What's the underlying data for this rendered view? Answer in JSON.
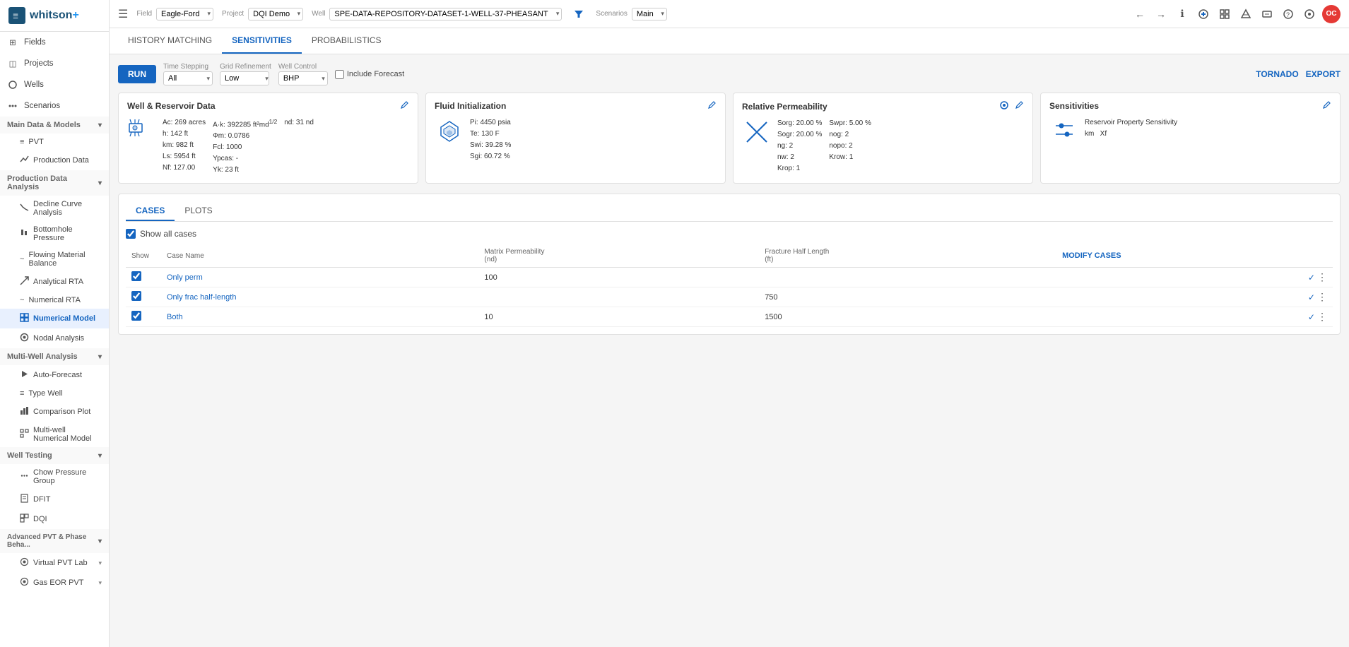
{
  "app": {
    "logo_text": "whitson",
    "logo_plus": "+",
    "menu_icon": "☰"
  },
  "topbar": {
    "field_label": "Field",
    "field_value": "Eagle-Ford",
    "project_label": "Project",
    "project_value": "DQI Demo",
    "well_label": "Well",
    "well_value": "SPE-DATA-REPOSITORY-DATASET-1-WELL-37-PHEASANT",
    "scenarios_label": "Scenarios",
    "scenarios_value": "Main",
    "filter_icon": "▼",
    "back_icon": "←",
    "forward_icon": "→",
    "info_icon": "ℹ",
    "user_avatar": "OC"
  },
  "sidebar": {
    "nav_items": [
      {
        "id": "fields",
        "label": "Fields",
        "icon": "⊞"
      },
      {
        "id": "projects",
        "label": "Projects",
        "icon": "◫"
      },
      {
        "id": "wells",
        "label": "Wells",
        "icon": "◯"
      },
      {
        "id": "scenarios",
        "label": "Scenarios",
        "icon": "⋯"
      }
    ],
    "sections": [
      {
        "id": "main-data",
        "label": "Main Data & Models",
        "collapsed": false,
        "items": [
          {
            "id": "pvt",
            "label": "PVT",
            "icon": "≡"
          },
          {
            "id": "production-data",
            "label": "Production Data",
            "icon": "📈"
          }
        ]
      },
      {
        "id": "production-data-analysis",
        "label": "Production Data Analysis",
        "collapsed": false,
        "items": [
          {
            "id": "decline-curve",
            "label": "Decline Curve Analysis",
            "icon": "📉"
          },
          {
            "id": "bottomhole-pressure",
            "label": "Bottomhole Pressure",
            "icon": "📊"
          },
          {
            "id": "flowing-material-balance",
            "label": "Flowing Material Balance",
            "icon": "~"
          },
          {
            "id": "analytical-rta",
            "label": "Analytical RTA",
            "icon": "↗"
          },
          {
            "id": "numerical-rta",
            "label": "Numerical RTA",
            "icon": "~"
          },
          {
            "id": "numerical-model",
            "label": "Numerical Model",
            "icon": "⊞",
            "active": true
          }
        ]
      },
      {
        "id": "nodal",
        "label": "",
        "collapsed": false,
        "items": [
          {
            "id": "nodal-analysis",
            "label": "Nodal Analysis",
            "icon": "⊙"
          }
        ]
      },
      {
        "id": "multi-well",
        "label": "Multi-Well Analysis",
        "collapsed": false,
        "items": [
          {
            "id": "auto-forecast",
            "label": "Auto-Forecast",
            "icon": "▶"
          },
          {
            "id": "type-well",
            "label": "Type Well",
            "icon": "≡"
          },
          {
            "id": "comparison-plot",
            "label": "Comparison Plot",
            "icon": "📊"
          },
          {
            "id": "multi-well-numerical",
            "label": "Multi-well Numerical Model",
            "icon": "⊞"
          }
        ]
      },
      {
        "id": "well-testing",
        "label": "Well Testing",
        "collapsed": false,
        "items": [
          {
            "id": "chow-pressure-group",
            "label": "Chow Pressure Group",
            "icon": "⋯"
          },
          {
            "id": "dfit",
            "label": "DFIT",
            "icon": "📄"
          },
          {
            "id": "dqi",
            "label": "DQI",
            "icon": "⊞"
          }
        ]
      },
      {
        "id": "advanced-pvt",
        "label": "Advanced PVT & Phase Beha...",
        "collapsed": false,
        "items": [
          {
            "id": "virtual-pvt-lab",
            "label": "Virtual PVT Lab",
            "icon": "⊙",
            "has_arrow": true
          },
          {
            "id": "gas-eor-pvt",
            "label": "Gas EOR PVT",
            "icon": "⊙",
            "has_arrow": true
          }
        ]
      }
    ]
  },
  "content_tabs": [
    {
      "id": "history-matching",
      "label": "HISTORY MATCHING",
      "active": false
    },
    {
      "id": "sensitivities",
      "label": "SENSITIVITIES",
      "active": true
    },
    {
      "id": "probabilistics",
      "label": "PROBABILISTICS",
      "active": false
    }
  ],
  "toolbar": {
    "run_label": "RUN",
    "time_stepping_label": "Time Stepping",
    "time_stepping_value": "All",
    "grid_refinement_label": "Grid Refinement",
    "grid_refinement_value": "Low",
    "well_control_label": "Well Control",
    "well_control_value": "BHP",
    "include_forecast_label": "Include Forecast",
    "tornado_label": "TORNADO",
    "export_label": "EXPORT"
  },
  "cards": {
    "well_reservoir": {
      "title": "Well & Reservoir Data",
      "data": {
        "Ac": "269 acres",
        "Ak": "392285 ft²md¹/²",
        "h": "142 ft",
        "Фm": "0.0786",
        "km": "982 ft",
        "Fcl": "1000",
        "Ls": "5954 ft",
        "Ypcas": "-",
        "Nf": "127.00",
        "Yk": "23 ft",
        "nd": "31 nd"
      }
    },
    "fluid_initialization": {
      "title": "Fluid Initialization",
      "data": {
        "Pi": "4450 psia",
        "Swi": "39.28 %",
        "Te": "130 F",
        "Sgi": "60.72 %"
      }
    },
    "relative_permeability": {
      "title": "Relative Permeability",
      "data": {
        "Sorg": "20.00 %",
        "Sogr": "20.00 %",
        "Swpr": "5.00 %",
        "ng": "2",
        "nw": "2",
        "nog": "2",
        "nopo": "2",
        "Krop": "1",
        "Krow": "1"
      }
    },
    "sensitivities": {
      "title": "Sensitivities",
      "data": {
        "property": "Reservoir Property Sensitivity",
        "km": "km",
        "Xf": "Xf"
      }
    }
  },
  "cases": {
    "tabs": [
      {
        "id": "cases",
        "label": "CASES",
        "active": true
      },
      {
        "id": "plots",
        "label": "PLOTS",
        "active": false
      }
    ],
    "show_all_label": "Show all cases",
    "columns": {
      "show": "Show",
      "case_name": "Case Name",
      "matrix_permeability_label": "Matrix Permeability",
      "matrix_permeability_unit": "(nd)",
      "fracture_half_length_label": "Fracture Half Length",
      "fracture_half_length_unit": "(ft)",
      "modify_cases": "MODIFY CASES"
    },
    "rows": [
      {
        "id": 1,
        "checked": true,
        "name": "Only perm",
        "matrix_perm": "100",
        "fracture_half_length": ""
      },
      {
        "id": 2,
        "checked": true,
        "name": "Only frac half-length",
        "matrix_perm": "",
        "fracture_half_length": "750"
      },
      {
        "id": 3,
        "checked": true,
        "name": "Both",
        "matrix_perm": "10",
        "fracture_half_length": "1500"
      }
    ]
  }
}
